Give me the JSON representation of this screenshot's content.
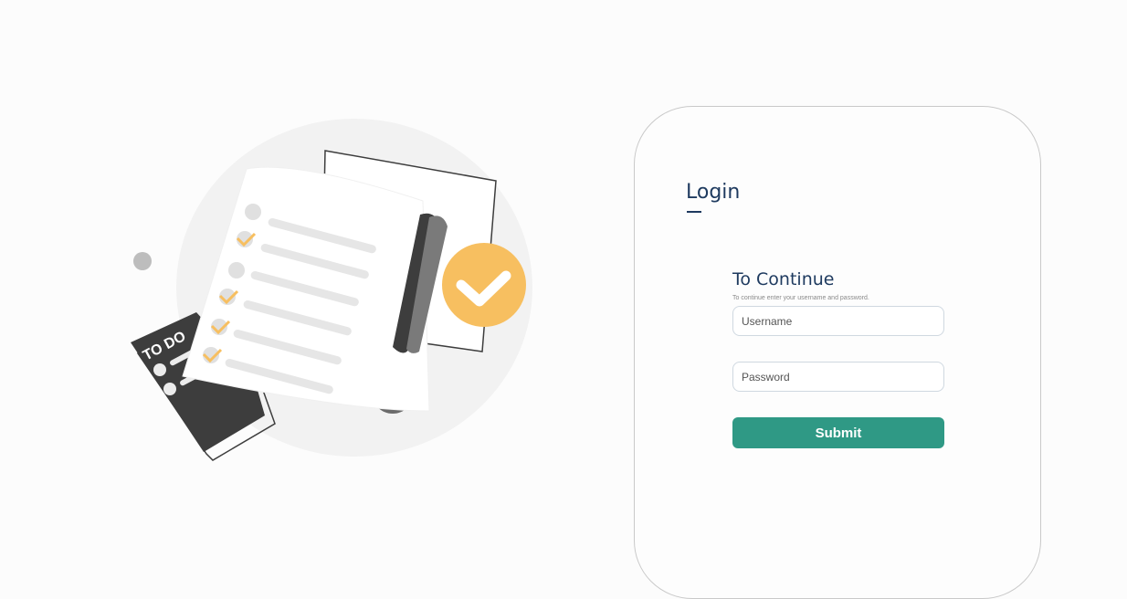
{
  "illustration": {
    "sign_text": "TO DO",
    "colors": {
      "accent_orange": "#f7bf60",
      "dark_gray": "#3d3d3d",
      "blob_bg": "#f2f2f2"
    }
  },
  "login": {
    "title": "Login",
    "subheading": "To Continue",
    "instructions": "To continue enter your username and password.",
    "username_placeholder": "Username",
    "password_placeholder": "Password",
    "submit_label": "Submit"
  },
  "colors": {
    "heading": "#1e3a5f",
    "button": "#2f9985",
    "card_border": "#c9c9c9"
  }
}
